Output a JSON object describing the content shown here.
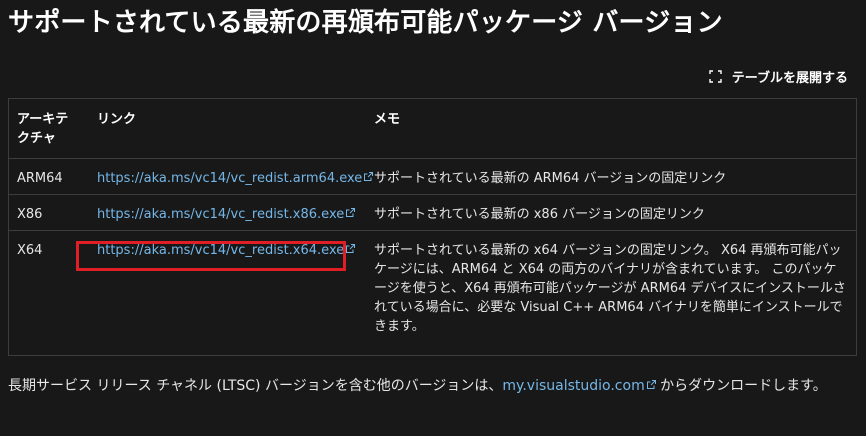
{
  "page": {
    "title": "サポートされている最新の再頒布可能パッケージ バージョン"
  },
  "toolbar": {
    "expand_label": "テーブルを展開する",
    "expand_icon": "expand-icon"
  },
  "table": {
    "headers": {
      "arch": "アーキテクチャ",
      "link": "リンク",
      "memo": "メモ"
    },
    "rows": [
      {
        "arch": "ARM64",
        "link": "https://aka.ms/vc14/vc_redist.arm64.exe",
        "memo": "サポートされている最新の ARM64 バージョンの固定リンク"
      },
      {
        "arch": "X86",
        "link": "https://aka.ms/vc14/vc_redist.x86.exe",
        "memo": "サポートされている最新の x86 バージョンの固定リンク"
      },
      {
        "arch": "X64",
        "link": "https://aka.ms/vc14/vc_redist.x64.exe",
        "memo": "サポートされている最新の x64 バージョンの固定リンク。 X64 再頒布可能パッケージには、ARM64 と X64 の両方のバイナリが含まれています。 このパッケージを使うと、X64 再頒布可能パッケージが ARM64 デバイスにインストールされている場合に、必要な Visual C++ ARM64 バイナリを簡単にインストールできます。"
      }
    ]
  },
  "footer": {
    "text_before": "長期サービス リリース チャネル (LTSC) バージョンを含む他のバージョンは、",
    "link": "my.visualstudio.com",
    "text_after": " からダウンロードします。"
  },
  "colors": {
    "background": "#181818",
    "link": "#75b6e7",
    "highlight": "#e01e26",
    "border": "#3d3d3d"
  }
}
